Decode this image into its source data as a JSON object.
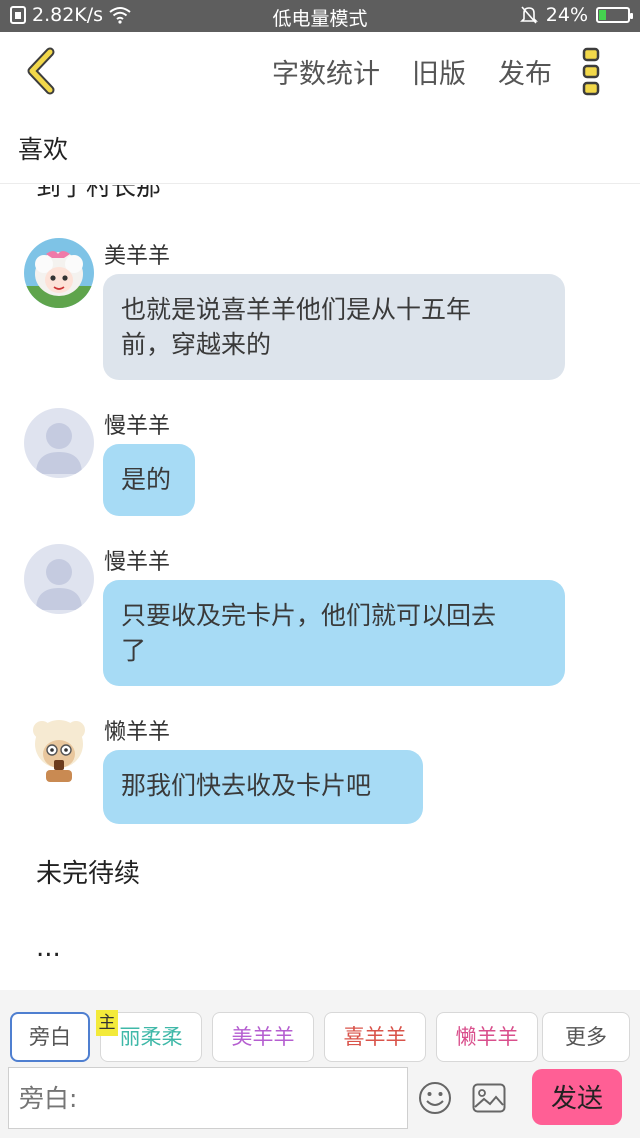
{
  "status_bar": {
    "speed": "2.82K/s",
    "mode": "低电量模式",
    "battery": "24%",
    "battery_level": 0.24,
    "icons": [
      "sim-icon",
      "wifi-icon",
      "bell-muted-icon",
      "battery-icon"
    ]
  },
  "topbar": {
    "actions": [
      "字数统计",
      "旧版",
      "发布"
    ],
    "icons": [
      "back-chevron-icon",
      "more-icon"
    ],
    "accent": "#f2d84a"
  },
  "title": "喜欢",
  "content": {
    "cut_text": "到了村长那",
    "messages": [
      {
        "name": "美羊羊",
        "text": "也就是说喜羊羊他们是从十五年前，穿越来的",
        "line1": "也就是说喜羊羊他们是从十五年",
        "line2": "前，穿越来的",
        "style": "gray",
        "avatar": "meiyangyang-avatar"
      },
      {
        "name": "慢羊羊",
        "text": "是的",
        "style": "blue",
        "avatar": "default-user-avatar"
      },
      {
        "name": "慢羊羊",
        "text": "只要收及完卡片，他们就可以回去了",
        "line1": "只要收及完卡片，他们就可以回去",
        "line2": "了",
        "style": "blue",
        "avatar": "default-user-avatar"
      },
      {
        "name": "懒羊羊",
        "text": "那我们快去收及卡片吧",
        "style": "blue",
        "avatar": "lanyangyang-avatar"
      }
    ],
    "narration_1": "未完待续",
    "narration_2": "..."
  },
  "characters": {
    "host_tag": "主",
    "chips": [
      {
        "label": "旁白",
        "color": "#555555",
        "selected": true
      },
      {
        "label": "丽柔柔",
        "color": "#3fb8a8"
      },
      {
        "label": "美羊羊",
        "color": "#b55ed0"
      },
      {
        "label": "喜羊羊",
        "color": "#d9534a"
      },
      {
        "label": "懒羊羊",
        "color": "#d94f8c"
      },
      {
        "label": "更多",
        "color": "#555555"
      }
    ]
  },
  "input": {
    "placeholder": "旁白:",
    "send_label": "发送",
    "icons": [
      "emoji-icon",
      "image-icon"
    ]
  }
}
